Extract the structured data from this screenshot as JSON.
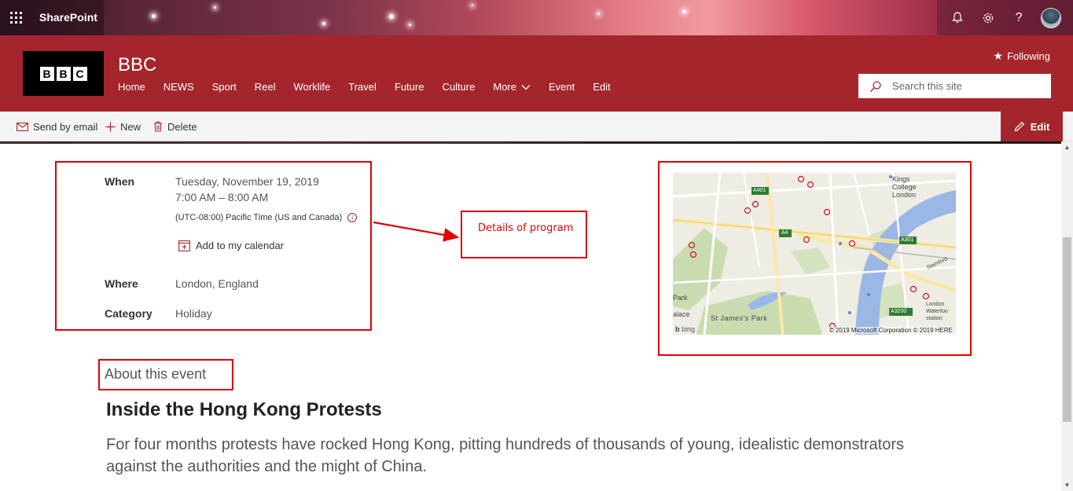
{
  "suite": {
    "brand": "SharePoint"
  },
  "site": {
    "title": "BBC",
    "logo_letters": [
      "B",
      "B",
      "C"
    ],
    "nav": [
      "Home",
      "NEWS",
      "Sport",
      "Reel",
      "Worklife",
      "Travel",
      "Future",
      "Culture",
      "More",
      "Event",
      "Edit"
    ],
    "following_label": "Following",
    "search_placeholder": "Search this site"
  },
  "commandbar": {
    "send_email": "Send by email",
    "new": "New",
    "delete": "Delete",
    "edit": "Edit"
  },
  "event": {
    "when_label": "When",
    "date": "Tuesday, November 19, 2019",
    "time": "7:00 AM – 8:00 AM",
    "timezone": "(UTC-08:00) Pacific Time (US and Canada)",
    "add_calendar": "Add to my calendar",
    "where_label": "Where",
    "where": "London, England",
    "category_label": "Category",
    "category": "Holiday",
    "about_heading": "About this event",
    "title": "Inside the Hong Kong Protests",
    "description": "For four months protests have rocked Hong Kong, pitting hundreds of thousands of young, idealistic demonstrators against the authorities and the might of China."
  },
  "annotation": {
    "text": "Details of program"
  },
  "map": {
    "credit": "© 2019 Microsoft Corporation © 2019 HERE",
    "bing": "bing",
    "labels": {
      "kings_college": "Kings College London",
      "st_james": "St James's Park",
      "waterloo": "London Waterloo station",
      "park": "Park",
      "palace": "alace",
      "stamford": "Stamford",
      "a401": "A401",
      "a4": "A4",
      "a301": "A301",
      "a3200": "A3200"
    }
  },
  "colors": {
    "brand": "#a4262c",
    "annotation": "#e00000"
  }
}
